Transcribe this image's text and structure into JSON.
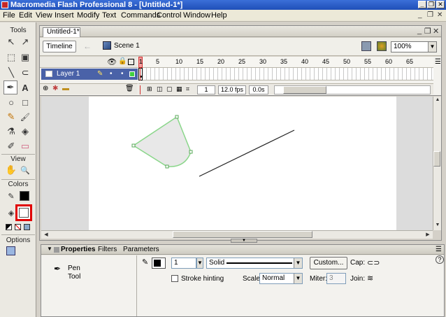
{
  "window": {
    "title": "Macromedia Flash Professional 8 - [Untitled-1*]",
    "controls": [
      "_",
      "❐",
      "✕"
    ]
  },
  "menu": [
    "File",
    "Edit",
    "View",
    "Insert",
    "Modify",
    "Text",
    "Commands",
    "Control",
    "Window",
    "Help"
  ],
  "menu_right": [
    "_",
    "❐",
    "✕"
  ],
  "tools": {
    "title": "Tools",
    "view_label": "View",
    "colors_label": "Colors",
    "options_label": "Options",
    "items": [
      {
        "name": "arrow",
        "glyph": "↖"
      },
      {
        "name": "subselect",
        "glyph": "↗"
      },
      {
        "name": "free-transform",
        "glyph": "⬚"
      },
      {
        "name": "gradient-transform",
        "glyph": "▣"
      },
      {
        "name": "line",
        "glyph": "╲"
      },
      {
        "name": "lasso",
        "glyph": "⊂"
      },
      {
        "name": "pen",
        "glyph": "✒"
      },
      {
        "name": "text",
        "glyph": "A"
      },
      {
        "name": "oval",
        "glyph": "○"
      },
      {
        "name": "rectangle",
        "glyph": "□"
      },
      {
        "name": "pencil",
        "glyph": "✎"
      },
      {
        "name": "brush",
        "glyph": "🖌"
      },
      {
        "name": "ink-bottle",
        "glyph": "⚗"
      },
      {
        "name": "paint-bucket",
        "glyph": "◈"
      },
      {
        "name": "eyedropper",
        "glyph": "✐"
      },
      {
        "name": "eraser",
        "glyph": "▭"
      }
    ],
    "view_items": [
      {
        "name": "hand",
        "glyph": "✋"
      },
      {
        "name": "zoom",
        "glyph": "🔍"
      }
    ]
  },
  "document": {
    "tab": "Untitled-1*",
    "timeline_button": "Timeline",
    "scene": "Scene 1",
    "zoom": "100%"
  },
  "timeline": {
    "layer_name": "Layer 1",
    "ruler": [
      "1",
      "5",
      "10",
      "15",
      "20",
      "25",
      "30",
      "35",
      "40",
      "45",
      "50",
      "55",
      "60",
      "65"
    ],
    "current_frame": "1",
    "fps": "12.0 fps",
    "elapsed": "0.0s"
  },
  "properties": {
    "tabs": [
      "Properties",
      "Filters",
      "Parameters"
    ],
    "tool_name_line1": "Pen",
    "tool_name_line2": "Tool",
    "stroke_height": "1",
    "stroke_style": "Solid",
    "custom_button": "Custom...",
    "cap_label": "Cap:",
    "stroke_hinting_label": "Stroke hinting",
    "scale_label": "Scale:",
    "scale_value": "Normal",
    "miter_label": "Miter:",
    "miter_value": "3",
    "join_label": "Join:",
    "help": "?"
  },
  "colors": {
    "stroke": "#000000",
    "fill": "#ffffff",
    "highlight": "#e00000",
    "shape_fill": "#e8e8e8",
    "shape_stroke": "#8ad68a",
    "layer_bg": "#4a62a8"
  }
}
